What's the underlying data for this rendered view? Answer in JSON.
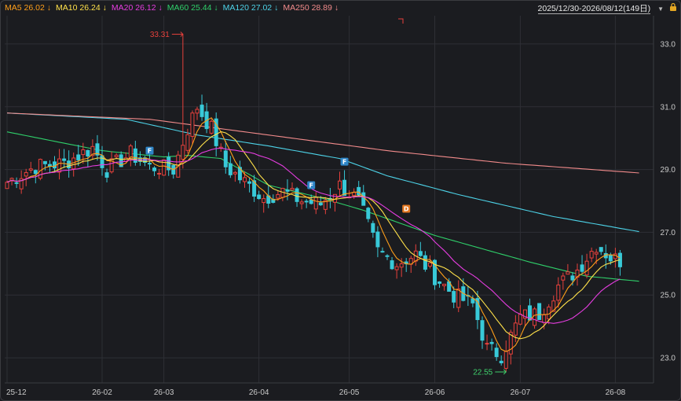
{
  "legend": [
    {
      "label": "MA5",
      "value": "26.02",
      "arrow": "↓",
      "color": "#ff9f1a"
    },
    {
      "label": "MA10",
      "value": "26.24",
      "arrow": "↓",
      "color": "#ffe14a"
    },
    {
      "label": "MA20",
      "value": "26.12",
      "arrow": "↓",
      "color": "#e63de0"
    },
    {
      "label": "MA60",
      "value": "25.44",
      "arrow": "↓",
      "color": "#2fcf6a"
    },
    {
      "label": "MA120",
      "value": "27.02",
      "arrow": "↓",
      "color": "#4dd3e8"
    },
    {
      "label": "MA250",
      "value": "28.89",
      "arrow": "↓",
      "color": "#f28b8b"
    }
  ],
  "range": {
    "label": "2025/12/30-2026/08/12(149日)",
    "caret": "▼"
  },
  "icons": {
    "lock": "lock-icon",
    "caret": "caret-down-icon"
  },
  "colors": {
    "up": "#e8413c",
    "down": "#38c9d8",
    "grid": "#2e2f35",
    "axis_text": "#c9c9c9"
  },
  "chart_data": {
    "type": "candlestick",
    "ylim": [
      22.2,
      33.9
    ],
    "yticks": [
      "33.0",
      "31.0",
      "29.0",
      "27.0",
      "25.0",
      "23.0"
    ],
    "xticks": [
      "25-12",
      "26-02",
      "26-03",
      "26-04",
      "26-05",
      "26-06",
      "26-07",
      "26-08"
    ],
    "xtick_index": [
      0,
      20,
      33,
      53,
      72,
      90,
      108,
      128
    ],
    "count": 130,
    "close_anchors": [
      [
        0,
        28.6
      ],
      [
        6,
        29.1
      ],
      [
        12,
        29.2
      ],
      [
        18,
        29.7
      ],
      [
        21,
        29.0
      ],
      [
        26,
        29.5
      ],
      [
        30,
        29.1
      ],
      [
        35,
        29.0
      ],
      [
        38,
        30.3
      ],
      [
        40,
        31.0
      ],
      [
        43,
        30.3
      ],
      [
        46,
        29.1
      ],
      [
        50,
        28.6
      ],
      [
        54,
        28.1
      ],
      [
        58,
        28.3
      ],
      [
        62,
        28.0
      ],
      [
        66,
        27.9
      ],
      [
        70,
        28.5
      ],
      [
        74,
        28.0
      ],
      [
        78,
        26.4
      ],
      [
        82,
        26.0
      ],
      [
        86,
        26.3
      ],
      [
        90,
        25.6
      ],
      [
        94,
        25.0
      ],
      [
        98,
        24.7
      ],
      [
        101,
        23.3
      ],
      [
        104,
        23.1
      ],
      [
        108,
        24.3
      ],
      [
        112,
        24.4
      ],
      [
        116,
        25.3
      ],
      [
        120,
        25.8
      ],
      [
        124,
        26.6
      ],
      [
        127,
        26.2
      ],
      [
        129,
        26.1
      ]
    ],
    "ma_series": [
      {
        "name": "MA5",
        "color": "#ff9f1a",
        "window": 5
      },
      {
        "name": "MA10",
        "color": "#ffe14a",
        "window": 10
      },
      {
        "name": "MA20",
        "color": "#e63de0",
        "window": 20
      },
      {
        "name": "MA60",
        "color": "#2fcf6a",
        "points": [
          [
            0,
            30.2
          ],
          [
            20,
            29.6
          ],
          [
            33,
            29.4
          ],
          [
            38,
            29.45
          ],
          [
            45,
            29.35
          ],
          [
            55,
            28.5
          ],
          [
            66,
            28.1
          ],
          [
            75,
            27.7
          ],
          [
            90,
            26.9
          ],
          [
            110,
            26.05
          ],
          [
            122,
            25.6
          ],
          [
            133,
            25.44
          ]
        ]
      },
      {
        "name": "MA120",
        "color": "#4dd3e8",
        "points": [
          [
            0,
            30.8
          ],
          [
            25,
            30.6
          ],
          [
            40,
            30.1
          ],
          [
            55,
            29.75
          ],
          [
            70,
            29.35
          ],
          [
            80,
            28.8
          ],
          [
            95,
            28.2
          ],
          [
            115,
            27.5
          ],
          [
            133,
            27.02
          ]
        ]
      },
      {
        "name": "MA250",
        "color": "#f28b8b",
        "points": [
          [
            0,
            30.8
          ],
          [
            30,
            30.6
          ],
          [
            55,
            30.1
          ],
          [
            80,
            29.6
          ],
          [
            105,
            29.2
          ],
          [
            133,
            28.89
          ]
        ]
      }
    ],
    "annotations": [
      {
        "text": "33.31",
        "index": 37,
        "value": 33.31,
        "side": "left",
        "color": "#e8413c"
      },
      {
        "text": "22.55",
        "index": 105,
        "value": 22.55,
        "side": "left",
        "color": "#3fcf6b"
      }
    ],
    "markers": [
      {
        "text": "F",
        "index": 30,
        "value": 29.6,
        "color": "#2f86c8"
      },
      {
        "text": "F",
        "index": 64,
        "value": 28.5,
        "color": "#2f86c8"
      },
      {
        "text": "F",
        "index": 71,
        "value": 29.25,
        "color": "#2f86c8"
      },
      {
        "text": "D",
        "index": 84,
        "value": 27.75,
        "color": "#e4761e"
      }
    ]
  }
}
